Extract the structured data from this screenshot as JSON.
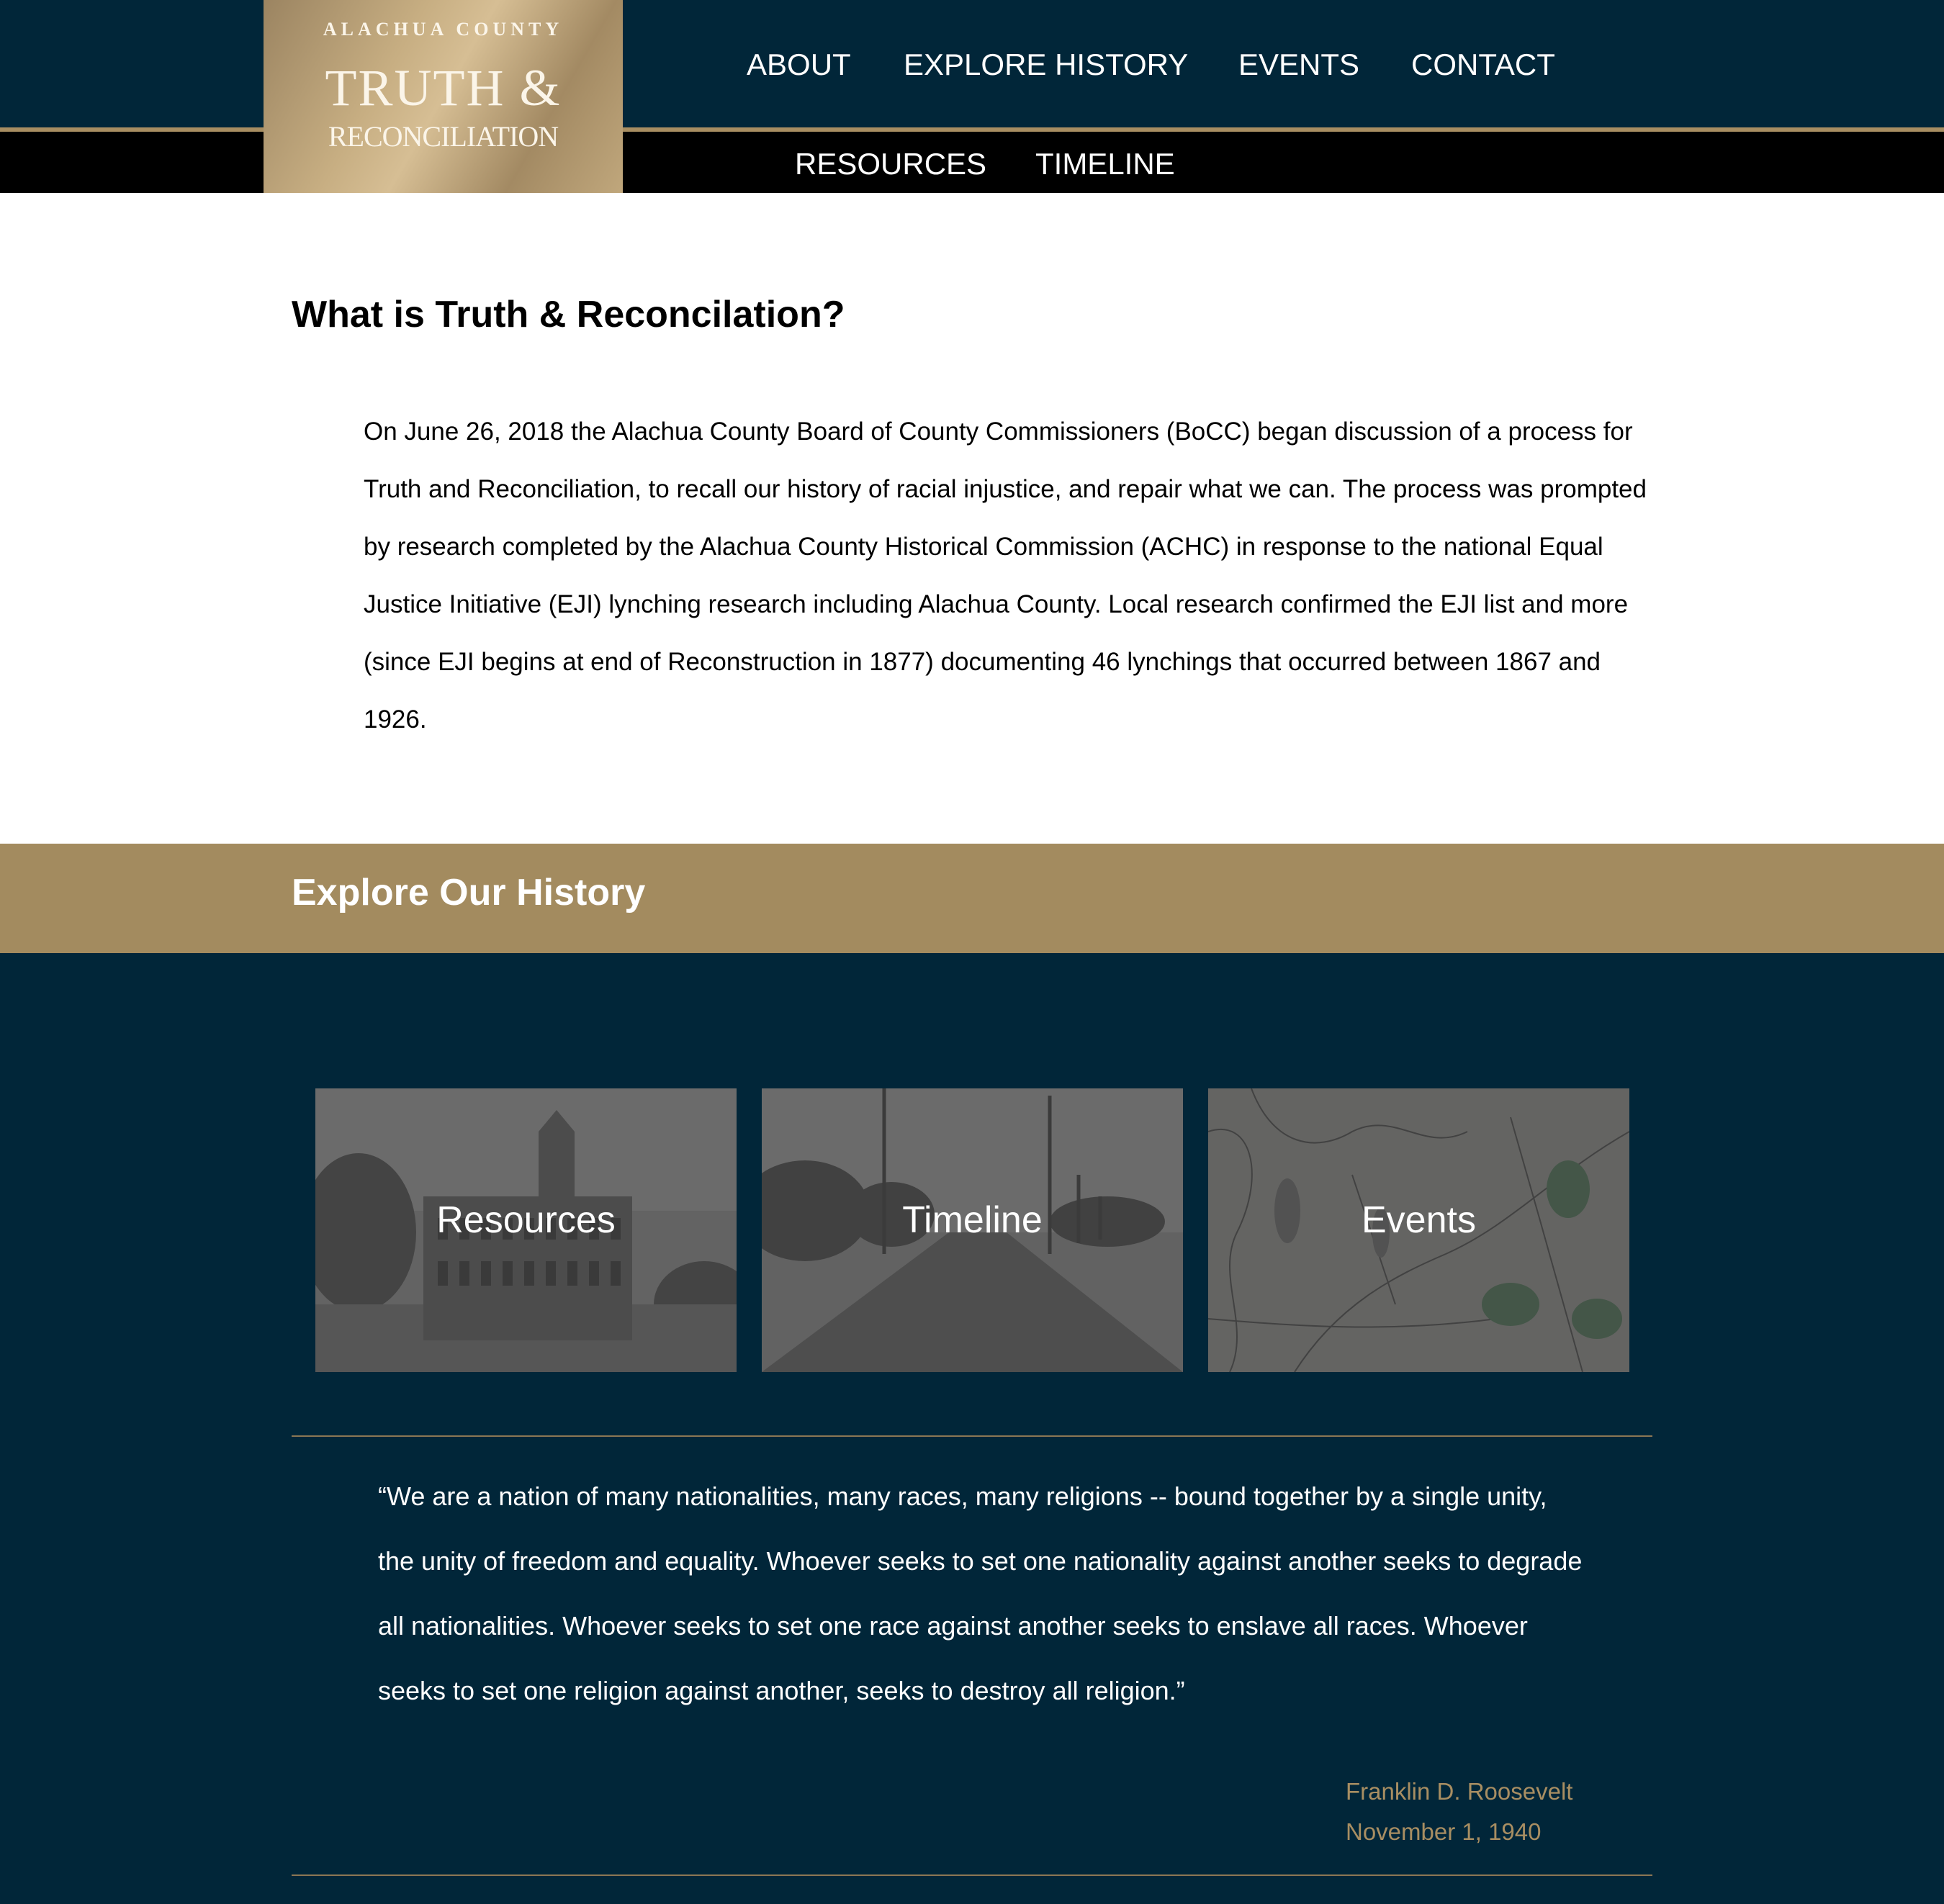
{
  "logo": {
    "county": "ALACHUA COUNTY",
    "truth": "TRUTH &",
    "reconciliation": "RECONCILIATION"
  },
  "nav": {
    "primary": [
      "ABOUT",
      "EXPLORE HISTORY",
      "EVENTS",
      "CONTACT"
    ],
    "secondary": [
      "RESOURCES",
      "TIMELINE"
    ]
  },
  "intro": {
    "title": "What is Truth & Reconcilation?",
    "body": "On June 26, 2018 the Alachua County Board of County Commissioners (BoCC) began discussion of a process for Truth and Reconciliation, to recall our history of racial injustice, and repair what we can. The process was prompted by research completed by the Alachua County Historical Commission (ACHC) in response to the national Equal Justice Initiative (EJI) lynching research including Alachua County. Local research confirmed the EJI list and more (since EJI begins at end of Reconstruction in 1877) documenting 46 lynchings that occurred between 1867 and 1926."
  },
  "explore": {
    "title": "Explore Our History",
    "cards": [
      {
        "label": "Resources",
        "image": "historic-courthouse-photo"
      },
      {
        "label": "Timeline",
        "image": "historic-dirt-road-photo"
      },
      {
        "label": "Events",
        "image": "historic-county-map"
      }
    ]
  },
  "quote": {
    "text": "“We are a nation of many nationalities, many races, many religions -- bound together by a single unity, the unity of freedom and equality. Whoever seeks to set one nationality against another seeks to degrade all nationalities. Whoever seeks to set one race against another seeks to enslave all races. Whoever seeks to set one religion against another, seeks to destroy all religion.”",
    "author": "Franklin D. Roosevelt",
    "date": "November 1, 1940"
  },
  "colors": {
    "navy": "#012639",
    "gold": "#a38b5f",
    "gold_text": "#a88e62",
    "black_bar": "#000000"
  }
}
